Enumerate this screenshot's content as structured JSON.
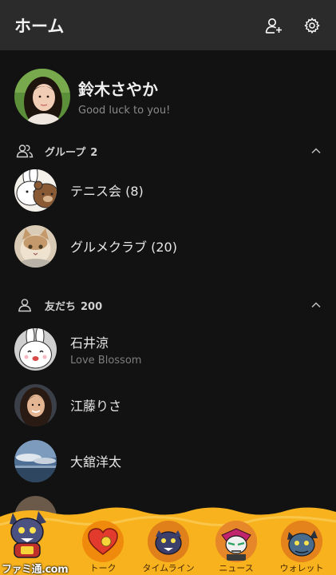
{
  "header": {
    "title": "ホーム",
    "add_friend_icon": "add-friend-icon",
    "settings_icon": "gear-icon"
  },
  "profile": {
    "name": "鈴木さやか",
    "status": "Good luck to you!"
  },
  "groups": {
    "label": "グループ",
    "count": "2",
    "items": [
      {
        "name": "テニス会 (8)"
      },
      {
        "name": "グルメクラブ (20)"
      }
    ]
  },
  "friends": {
    "label": "友だち",
    "count": "200",
    "items": [
      {
        "name": "石井涼",
        "status": "Love Blossom"
      },
      {
        "name": "江藤りさ"
      },
      {
        "name": "大舘洋太"
      }
    ]
  },
  "tabs": [
    {
      "label": "トーク",
      "icon": "heart-icon"
    },
    {
      "label": "タイムライン",
      "icon": "timeline-icon"
    },
    {
      "label": "ニュース",
      "icon": "news-icon"
    },
    {
      "label": "ウォレット",
      "icon": "wallet-icon"
    }
  ],
  "watermark": "ファミ通.com",
  "colors": {
    "header_bg": "#2b2b2b",
    "background": "#121212",
    "tabbar": "#f7b21d",
    "tab_circle": "#f08a0c"
  }
}
